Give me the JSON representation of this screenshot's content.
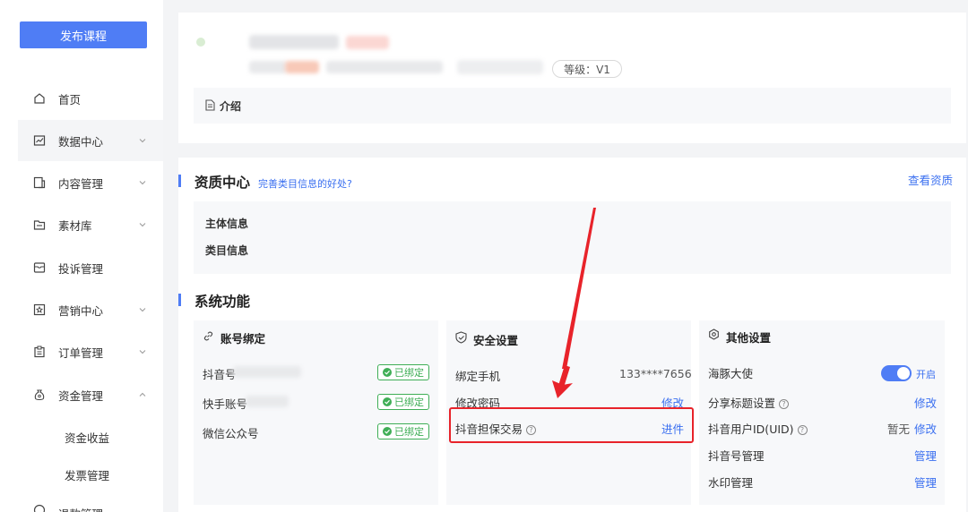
{
  "sidebar": {
    "publish_label": "发布课程",
    "items": [
      {
        "label": "首页",
        "icon": "home-icon"
      },
      {
        "label": "数据中心",
        "icon": "chart-icon"
      },
      {
        "label": "内容管理",
        "icon": "content-icon"
      },
      {
        "label": "素材库",
        "icon": "folder-icon"
      },
      {
        "label": "投诉管理",
        "icon": "complaint-icon"
      },
      {
        "label": "营销中心",
        "icon": "star-icon"
      },
      {
        "label": "订单管理",
        "icon": "clipboard-icon"
      },
      {
        "label": "资金管理",
        "icon": "money-bag-icon"
      }
    ],
    "sub_items": [
      "资金收益",
      "发票管理"
    ],
    "partial_item": "退款管理"
  },
  "profile": {
    "level": "等级：V1",
    "intro_label": "介绍"
  },
  "qualification": {
    "title": "资质中心",
    "hint": "完善类目信息的好处?",
    "view_link": "查看资质",
    "rows": [
      "主体信息",
      "类目信息"
    ]
  },
  "system": {
    "title": "系统功能",
    "account": {
      "title": "账号绑定",
      "rows": [
        {
          "label": "抖音号",
          "status": "已绑定"
        },
        {
          "label": "快手账号",
          "status": "已绑定"
        },
        {
          "label": "微信公众号",
          "status": "已绑定"
        }
      ]
    },
    "security": {
      "title": "安全设置",
      "phone_label": "绑定手机",
      "phone_value": "133****7656",
      "password_label": "修改密码",
      "password_action": "修改",
      "escrow_label": "抖音担保交易",
      "escrow_action": "进件"
    },
    "other": {
      "title": "其他设置",
      "dolphin_label": "海豚大使",
      "dolphin_state": "开启",
      "share_label": "分享标题设置",
      "share_action": "修改",
      "uid_label": "抖音用户ID(UID)",
      "uid_value": "暂无",
      "uid_action": "修改",
      "douyin_mgmt_label": "抖音号管理",
      "douyin_mgmt_action": "管理",
      "watermark_label": "水印管理",
      "watermark_action": "管理"
    }
  },
  "colors": {
    "accent": "#4f7df5",
    "link": "#3a6ff0",
    "bound": "#3fae56",
    "highlight": "#e8232a"
  }
}
